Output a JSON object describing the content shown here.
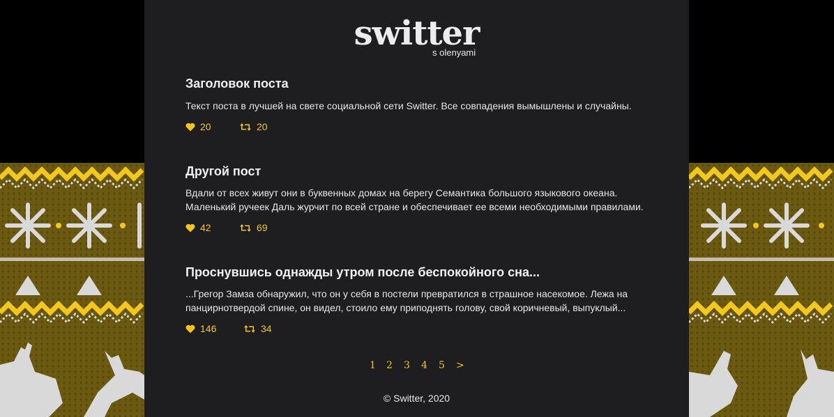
{
  "brand": {
    "logo": "switter",
    "tagline": "s olenyami"
  },
  "colors": {
    "accent": "#f5c518",
    "panel": "#1e1e21",
    "knit_base": "#6b5a10",
    "knit_yellow": "#f2c81e",
    "knit_white": "#d9d9d9"
  },
  "posts": [
    {
      "title": "Заголовок поста",
      "body_lines": [
        "Текст поста в лучшей на свете социальной сети Switter. Все совпадения вымышлены и случайны."
      ],
      "likes": "20",
      "reposts": "20"
    },
    {
      "title": "Другой пост",
      "body_lines": [
        "Вдали от всех живут они в буквенных домах на берегу Семантика большого языкового океана.",
        "Маленький ручеек Даль журчит по всей стране и обеспечивает ее всеми необходимыми правилами."
      ],
      "likes": "42",
      "reposts": "69"
    },
    {
      "title": "Проснувшись однажды утром после беспокойного сна...",
      "body_lines": [
        "...Грегор Замза обнаружил, что он у себя в постели превратился в страшное насекомое. Лежа на",
        "панцирнотвердой спине, он видел, стоило ему приподнять голову, свой коричневый, выпуклый..."
      ],
      "likes": "146",
      "reposts": "34"
    }
  ],
  "icons": {
    "like": "heart-icon",
    "repost": "retweet-icon"
  },
  "pagination": {
    "pages": [
      "1",
      "2",
      "3",
      "4",
      "5"
    ],
    "next": ">"
  },
  "footer": {
    "copyright": "© Switter, 2020"
  }
}
